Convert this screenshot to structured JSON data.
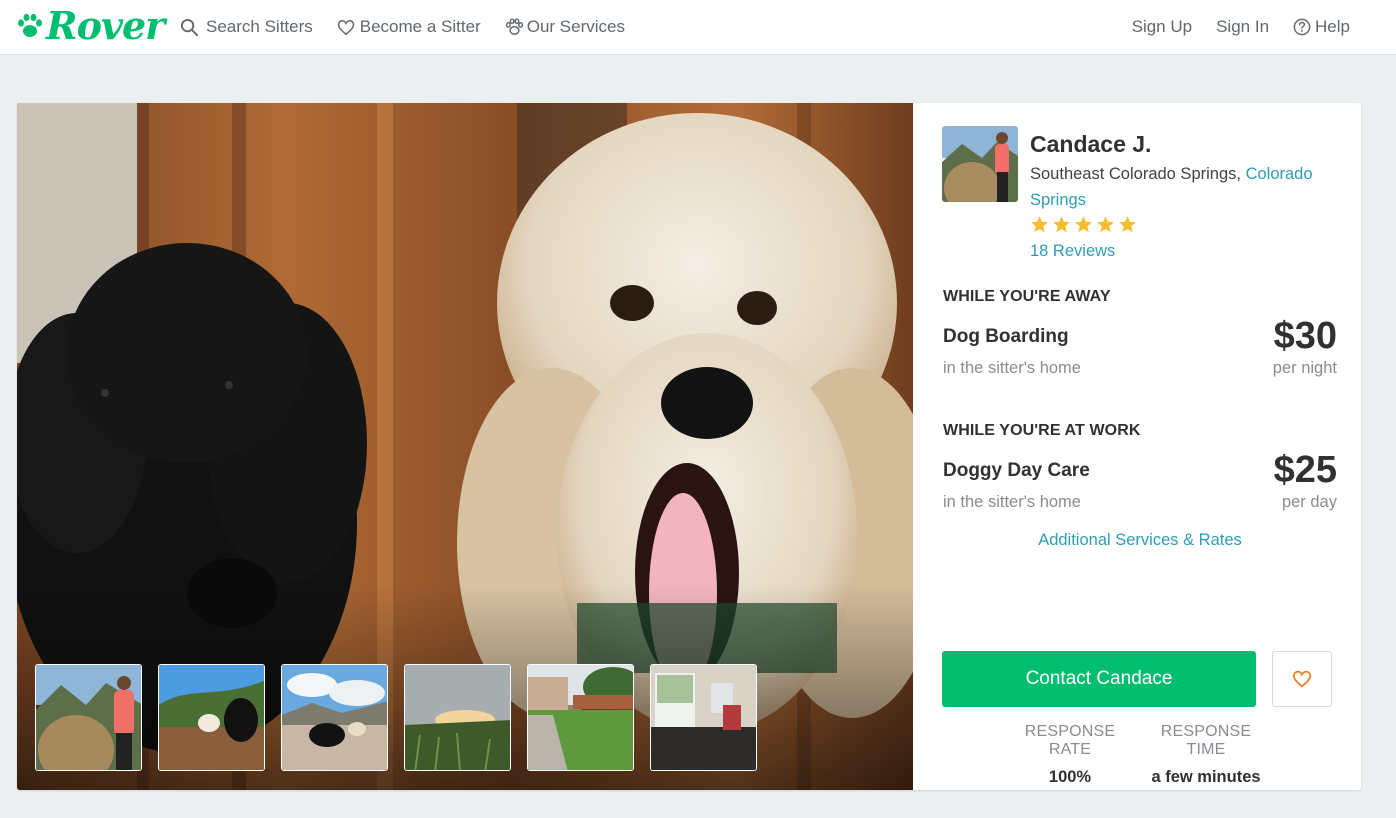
{
  "brand": {
    "name": "Rover",
    "color": "#00bd70",
    "icon": "paw-icon"
  },
  "nav": {
    "left": [
      {
        "label": "Search Sitters",
        "icon": "search-icon"
      },
      {
        "label": "Become a Sitter",
        "icon": "heart-icon"
      },
      {
        "label": "Our Services",
        "icon": "paw-icon"
      }
    ],
    "right": [
      {
        "label": "Sign Up"
      },
      {
        "label": "Sign In"
      },
      {
        "label": "Help",
        "icon": "help-icon"
      }
    ]
  },
  "profile": {
    "name": "Candace J.",
    "neighborhood": "Southeast Colorado Springs,",
    "city": "Colorado Springs",
    "rating": 5,
    "reviews": "18 Reviews"
  },
  "services": [
    {
      "heading": "WHILE YOU'RE AWAY",
      "name": "Dog Boarding",
      "where": "in the sitter's home",
      "price": "$30",
      "unit": "per night"
    },
    {
      "heading": "WHILE YOU'RE AT WORK",
      "name": "Doggy Day Care",
      "where": "in the sitter's home",
      "price": "$25",
      "unit": "per day"
    }
  ],
  "more_link": "Additional Services & Rates",
  "contact_button": "Contact Candace",
  "favorite": {
    "icon": "heart-icon"
  },
  "stats": [
    {
      "label": "RESPONSE RATE",
      "value": "100%"
    },
    {
      "label": "RESPONSE TIME",
      "value": "a few minutes"
    }
  ],
  "photos": {
    "thumbnail_count": 6
  },
  "colors": {
    "accent": "#00bd70",
    "link": "#2e9db4",
    "star": "#f6be2c",
    "heart": "#e8832a"
  }
}
